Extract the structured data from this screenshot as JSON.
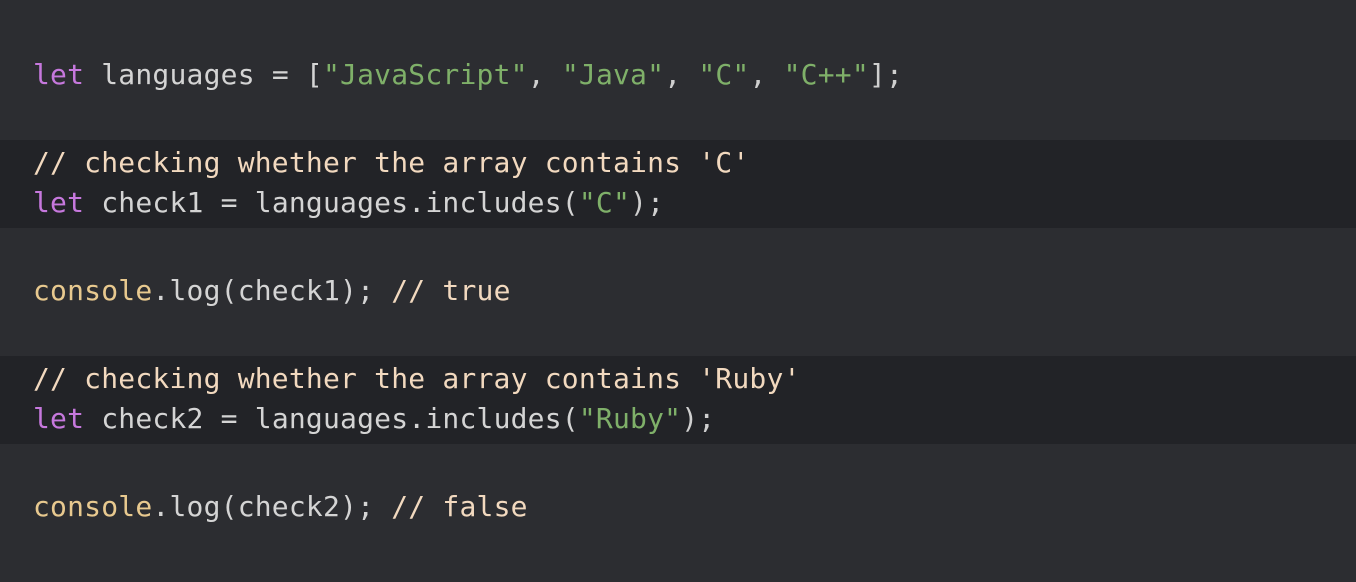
{
  "colors": {
    "background": "#2c2d31",
    "highlight_band": "#222327",
    "keyword": "#c678dd",
    "plain": "#d4d4d4",
    "string": "#7fb069",
    "comment": "#f2d9bf",
    "object": "#e8c98f"
  },
  "code": {
    "line1": {
      "k_let": "let",
      "t1": " languages = [",
      "s1": "\"JavaScript\"",
      "t2": ", ",
      "s2": "\"Java\"",
      "t3": ", ",
      "s3": "\"C\"",
      "t4": ", ",
      "s4": "\"C++\"",
      "t5": "];"
    },
    "line2": {
      "comment": "// checking whether the array contains 'C'"
    },
    "line3": {
      "k_let": "let",
      "t1": " check1 = languages.includes(",
      "s1": "\"C\"",
      "t2": ");"
    },
    "line4": {
      "obj": "console",
      "t1": ".log(check1); ",
      "comment": "// true"
    },
    "line5": {
      "comment": "// checking whether the array contains 'Ruby'"
    },
    "line6": {
      "k_let": "let",
      "t1": " check2 = languages.includes(",
      "s1": "\"Ruby\"",
      "t2": ");"
    },
    "line7": {
      "obj": "console",
      "t1": ".log(check2); ",
      "comment": "// false"
    }
  }
}
